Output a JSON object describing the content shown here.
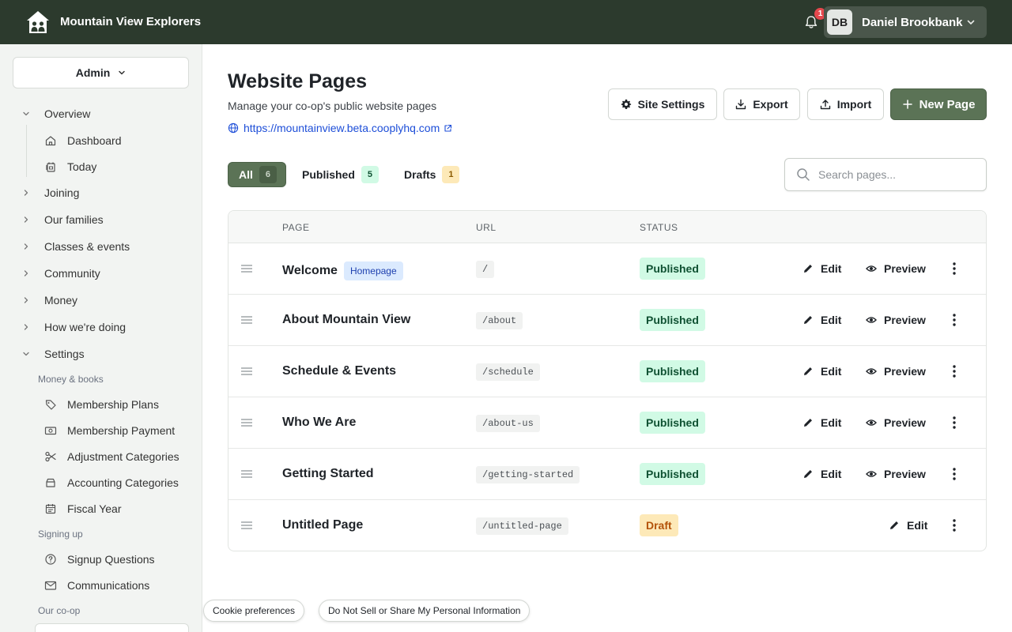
{
  "topbar": {
    "org_name": "Mountain View Explorers",
    "notification_count": "1",
    "user_initials": "DB",
    "user_name": "Daniel Brookbank"
  },
  "sidebar": {
    "role": "Admin",
    "groups": [
      {
        "label": "Overview",
        "expanded": true
      },
      {
        "label": "Joining",
        "expanded": false
      },
      {
        "label": "Our families",
        "expanded": false
      },
      {
        "label": "Classes & events",
        "expanded": false
      },
      {
        "label": "Community",
        "expanded": false
      },
      {
        "label": "Money",
        "expanded": false
      },
      {
        "label": "How we're doing",
        "expanded": false
      },
      {
        "label": "Settings",
        "expanded": true
      }
    ],
    "overview_items": [
      {
        "label": "Dashboard",
        "icon": "home-icon"
      },
      {
        "label": "Today",
        "icon": "calendar-day-icon"
      }
    ],
    "sections": {
      "money_books": "Money & books",
      "signing_up": "Signing up",
      "our_coop": "Our co-op"
    },
    "money_items": [
      {
        "label": "Membership Plans",
        "icon": "tag-icon"
      },
      {
        "label": "Membership Payment",
        "icon": "payment-icon"
      },
      {
        "label": "Adjustment Categories",
        "icon": "scissors-icon"
      },
      {
        "label": "Accounting Categories",
        "icon": "archive-icon"
      },
      {
        "label": "Fiscal Year",
        "icon": "calendar-icon"
      }
    ],
    "signup_items": [
      {
        "label": "Signup Questions",
        "icon": "question-icon"
      },
      {
        "label": "Communications",
        "icon": "mail-icon"
      }
    ]
  },
  "main": {
    "title": "Website Pages",
    "subtitle": "Manage your co-op's public website pages",
    "site_url": "https://mountainview.beta.cooplyhq.com",
    "buttons": {
      "site_settings": "Site Settings",
      "export": "Export",
      "import": "Import",
      "new_page": "New Page"
    },
    "filters": [
      {
        "label": "All",
        "count": "6",
        "active": true
      },
      {
        "label": "Published",
        "count": "5",
        "active": false
      },
      {
        "label": "Drafts",
        "count": "1",
        "active": false
      }
    ],
    "search_placeholder": "Search pages...",
    "table": {
      "headers": [
        "PAGE",
        "URL",
        "STATUS"
      ],
      "rows": [
        {
          "name": "Welcome",
          "badge": "Homepage",
          "url": "/",
          "status": "Published",
          "edit": "Edit",
          "preview": "Preview"
        },
        {
          "name": "About Mountain View",
          "badge": "",
          "url": "/about",
          "status": "Published",
          "edit": "Edit",
          "preview": "Preview"
        },
        {
          "name": "Schedule & Events",
          "badge": "",
          "url": "/schedule",
          "status": "Published",
          "edit": "Edit",
          "preview": "Preview"
        },
        {
          "name": "Who We Are",
          "badge": "",
          "url": "/about-us",
          "status": "Published",
          "edit": "Edit",
          "preview": "Preview"
        },
        {
          "name": "Getting Started",
          "badge": "",
          "url": "/getting-started",
          "status": "Published",
          "edit": "Edit",
          "preview": "Preview"
        },
        {
          "name": "Untitled Page",
          "badge": "",
          "url": "/untitled-page",
          "status": "Draft",
          "edit": "Edit",
          "preview": ""
        }
      ]
    }
  },
  "cookie_bar": {
    "preferences": "Cookie preferences",
    "do_not_sell": "Do Not Sell or Share My Personal Information"
  },
  "colors": {
    "topbar": "#2c3a2d",
    "primary": "#5b7356",
    "published_bg": "#d1fae5",
    "draft_bg": "#fde9b8",
    "link": "#1d4ed8"
  }
}
